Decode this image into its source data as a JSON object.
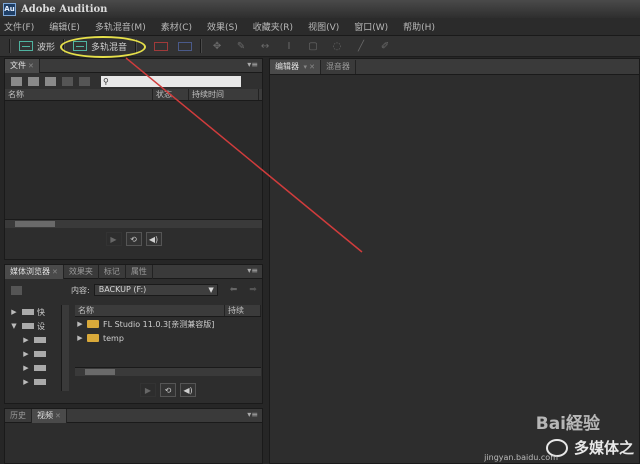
{
  "app": {
    "icon_label": "Au",
    "title": "Adobe Audition"
  },
  "menu": [
    "文件(F)",
    "编辑(E)",
    "多轨混音(M)",
    "素材(C)",
    "效果(S)",
    "收藏夹(R)",
    "视图(V)",
    "窗口(W)",
    "帮助(H)"
  ],
  "toolbar": {
    "waveform_label": "波形",
    "multitrack_label": "多轨混音"
  },
  "files_panel": {
    "tab": "文件",
    "columns": {
      "name": "名称",
      "status": "状态",
      "duration": "持续时间"
    }
  },
  "editor_panel": {
    "tabs": [
      "编辑器",
      "混音器"
    ]
  },
  "media_panel": {
    "tabs": [
      "媒体浏览器",
      "效果夹",
      "标记",
      "属性"
    ],
    "content_label": "内容:",
    "location": "BACKUP (F:)",
    "left_tree": [
      "快",
      "设"
    ],
    "columns": {
      "name": "名称",
      "duration": "持续"
    },
    "folders": [
      "FL Studio 11.0.3[亲测兼容版]",
      "temp"
    ]
  },
  "history_panel": {
    "tabs": [
      "历史",
      "视频"
    ]
  },
  "watermark": {
    "brand": "多媒体之",
    "baidu": "Bai経验",
    "sub": "jingyan.baidu.com"
  },
  "colors": {
    "annotation_ellipse": "#e6e04a",
    "annotation_arrow": "#d03c3c",
    "waveform_accent": "#4fb3a0"
  }
}
